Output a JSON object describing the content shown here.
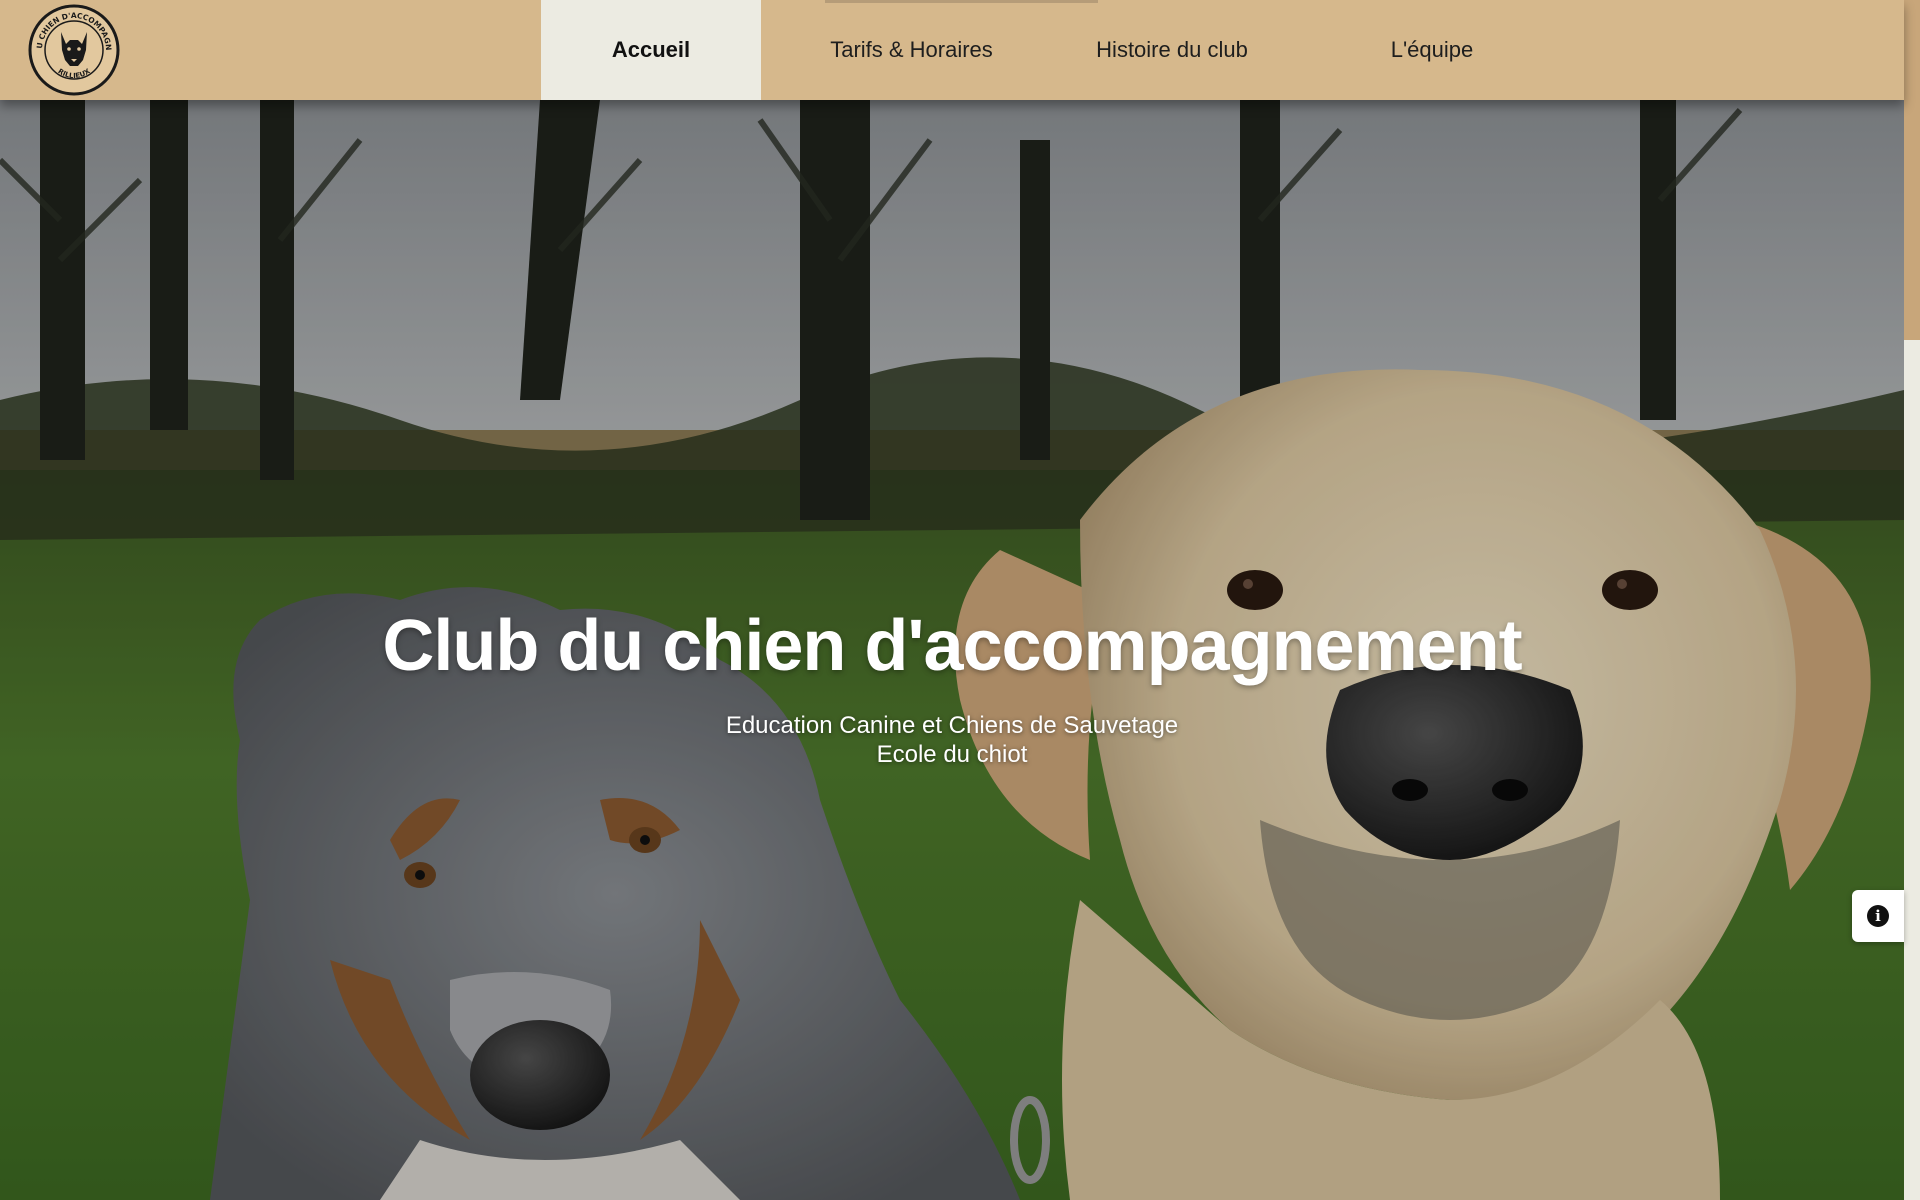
{
  "header": {
    "logo": {
      "text_top": "CLUB DU CHIEN D'ACCOMPAGNEMENT",
      "text_bottom": "RILLIEUX",
      "icon": "dog-head-emblem"
    },
    "nav": [
      {
        "label": "Accueil",
        "active": true
      },
      {
        "label": "Tarifs & Horaires",
        "active": false
      },
      {
        "label": "Histoire du club",
        "active": false
      },
      {
        "label": "L'équipe",
        "active": false
      }
    ]
  },
  "hero": {
    "title": "Club du chien d'accompagnement",
    "subtitle_line1": "Education Canine et Chiens de Sauvetage",
    "subtitle_line2": "Ecole du chiot",
    "image": "two dogs (australian shepherd and yellow labrador) in a grassy field with trees"
  },
  "widgets": {
    "info_icon": "info-icon"
  },
  "colors": {
    "header_bg": "#d6b88c",
    "nav_active_bg": "#ecebe2",
    "scroll_thumb": "#c8a67a"
  }
}
